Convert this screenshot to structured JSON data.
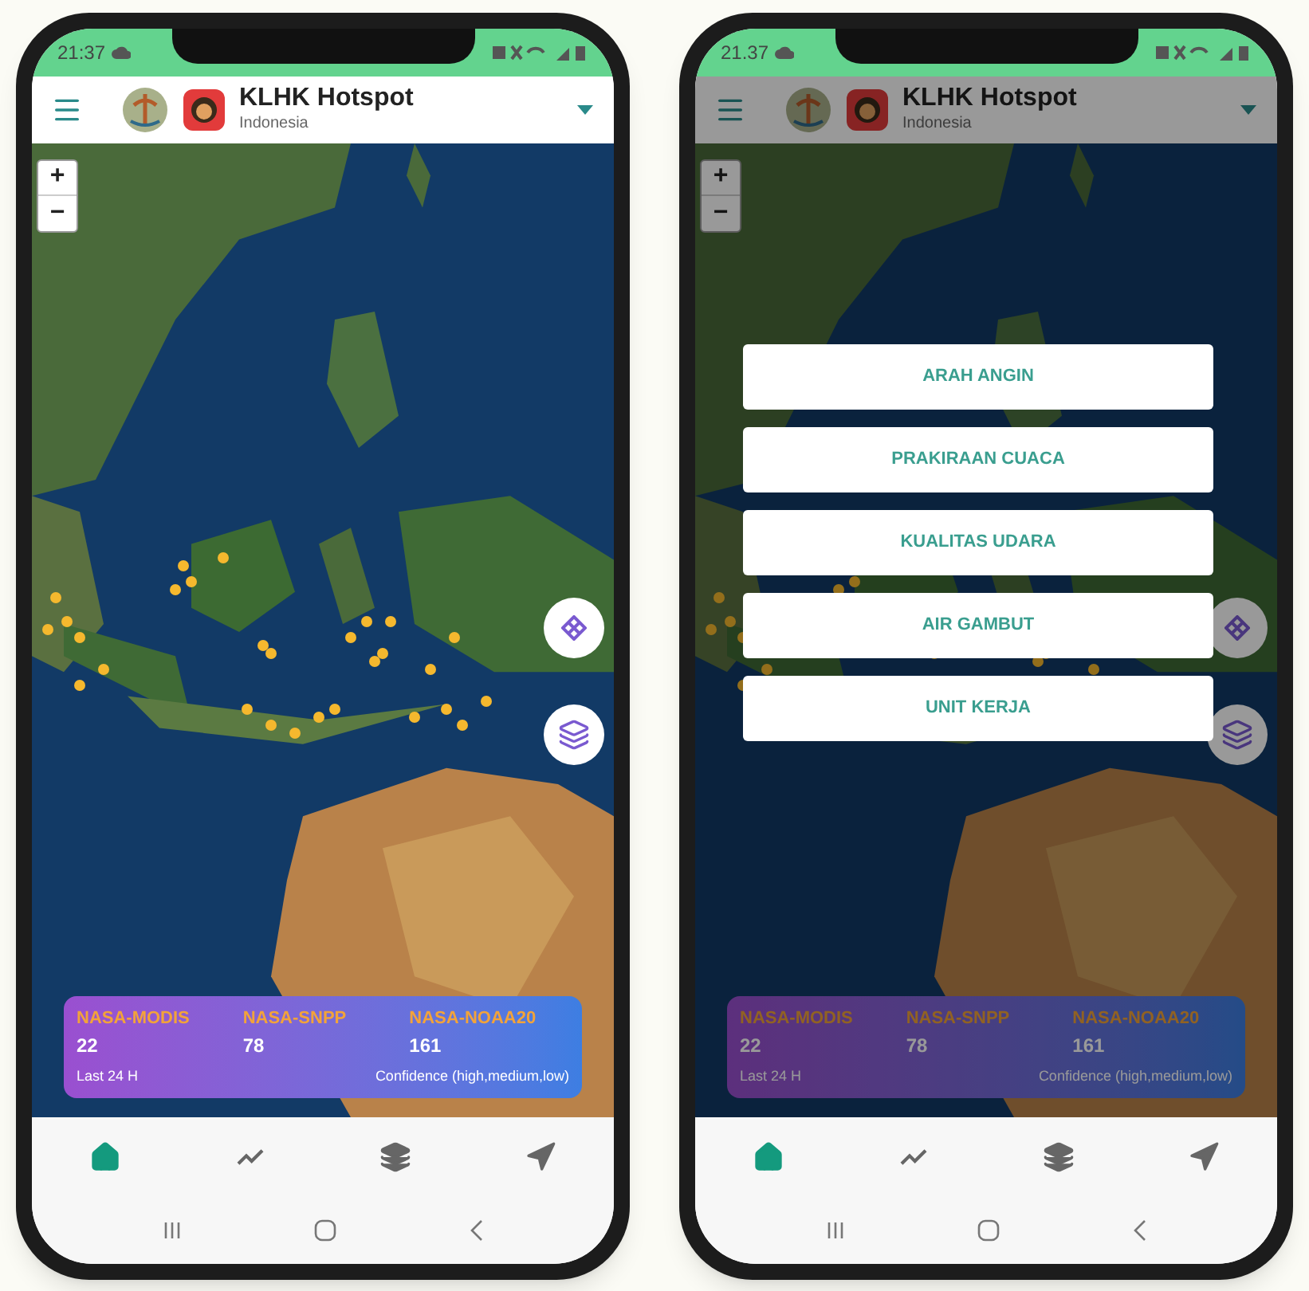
{
  "phones": [
    {
      "status_bar": {
        "time": "21:37"
      },
      "app_bar": {
        "title": "KLHK Hotspot",
        "subtitle": "Indonesia"
      },
      "zoom_controls": [
        "+",
        "−"
      ],
      "dimmed": false,
      "legend": {
        "sources": [
          {
            "name": "NASA-MODIS",
            "count": "22"
          },
          {
            "name": "NASA-SNPP",
            "count": "78"
          },
          {
            "name": "NASA-NOAA20",
            "count": "161"
          }
        ],
        "period": "Last 24 H",
        "note": "Confidence (high,medium,low)"
      },
      "nav": [
        {
          "kind": "home",
          "selected": true
        },
        {
          "kind": "trend",
          "selected": false
        },
        {
          "kind": "layers",
          "selected": false
        },
        {
          "kind": "location",
          "selected": false
        }
      ]
    },
    {
      "status_bar": {
        "time": "21.37"
      },
      "app_bar": {
        "title": "KLHK Hotspot",
        "subtitle": "Indonesia"
      },
      "zoom_controls": [
        "+",
        "−"
      ],
      "dimmed": true,
      "menu": [
        "ARAH ANGIN",
        "PRAKIRAAN CUACA",
        "KUALITAS UDARA",
        "AIR GAMBUT",
        "UNIT KERJA"
      ],
      "legend": {
        "sources": [
          {
            "name": "NASA-MODIS",
            "count": "22"
          },
          {
            "name": "NASA-SNPP",
            "count": "78"
          },
          {
            "name": "NASA-NOAA20",
            "count": "161"
          }
        ],
        "period": "Last 24 H",
        "note": "Confidence (high,medium,low)"
      },
      "nav": [
        {
          "kind": "home",
          "selected": true
        },
        {
          "kind": "trend",
          "selected": false
        },
        {
          "kind": "layers",
          "selected": false
        },
        {
          "kind": "location",
          "selected": false
        }
      ]
    }
  ]
}
